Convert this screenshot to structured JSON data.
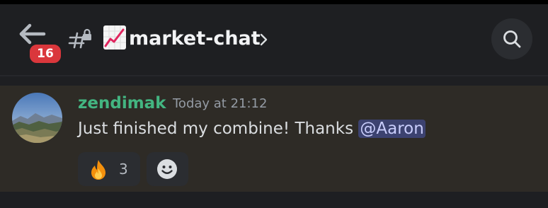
{
  "header": {
    "unread_badge": "16",
    "channel_name": "market-chat",
    "back_icon": "arrow-left-icon",
    "channel_icon": "locked-hashtag-icon",
    "channel_emoji": "chart-increasing-emoji",
    "chevron_icon": "chevron-right-icon",
    "search_icon": "search-icon"
  },
  "message": {
    "author": "zendimak",
    "author_color": "#43b581",
    "timestamp": "Today at 21:12",
    "text_before_mention": "Just finished my combine! Thanks ",
    "mention": "@Aaron",
    "reactions": [
      {
        "emoji": "fire-emoji",
        "count": "3"
      }
    ],
    "add_reaction_icon": "smiley-add-reaction-icon"
  },
  "colors": {
    "background": "#1e1f22",
    "highlighted_message_bg": "#2e2b26",
    "badge": "#da373c",
    "mention_bg": "#3c4270"
  }
}
